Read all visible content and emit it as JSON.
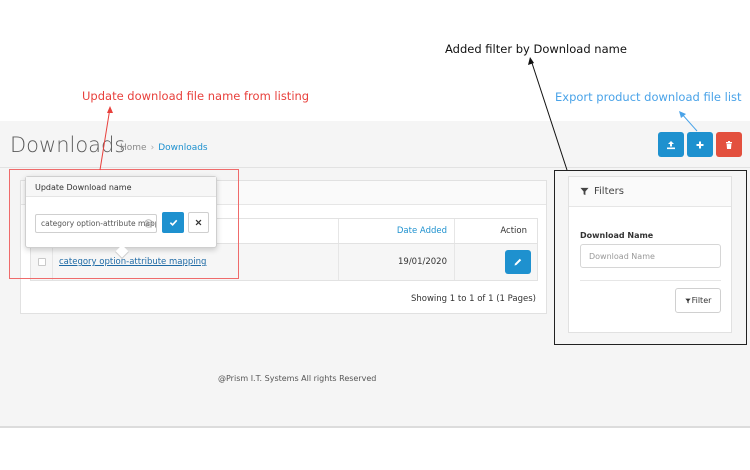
{
  "annotations": {
    "red": "Update download file name from listing",
    "black": "Added filter by Download name",
    "blue": "Export product download file list",
    "colors": {
      "red": "#e8403c",
      "black": "#111111",
      "blue": "#4aa3e8"
    }
  },
  "header": {
    "title": "Downloads",
    "breadcrumb": {
      "home": "Home",
      "separator": "›",
      "current": "Downloads"
    }
  },
  "toolbar": {
    "export_icon": "export-upload-icon",
    "add_icon": "plus-icon",
    "delete_icon": "trash-icon",
    "colors": {
      "primary": "#1e91cf",
      "danger": "#e3503e"
    }
  },
  "table": {
    "columns": {
      "date_added": "Date Added",
      "action": "Action"
    },
    "rows": [
      {
        "name": "category option-attribute mapping",
        "date_added": "19/01/2020",
        "action_icon": "pencil-icon"
      }
    ],
    "pagination_info": "Showing 1 to 1 of 1 (1 Pages)"
  },
  "popover": {
    "title": "Update Download name",
    "input_value": "category option-attribute mapping",
    "clear_icon": "clear-circle-icon",
    "confirm_icon": "check-icon",
    "cancel_icon": "times-icon"
  },
  "filter": {
    "heading": "Filters",
    "label": "Download Name",
    "placeholder": "Download Name",
    "button_label": "Filter",
    "icon": "filter-icon"
  },
  "footer": {
    "text": "@Prism I.T. Systems All rights Reserved"
  }
}
